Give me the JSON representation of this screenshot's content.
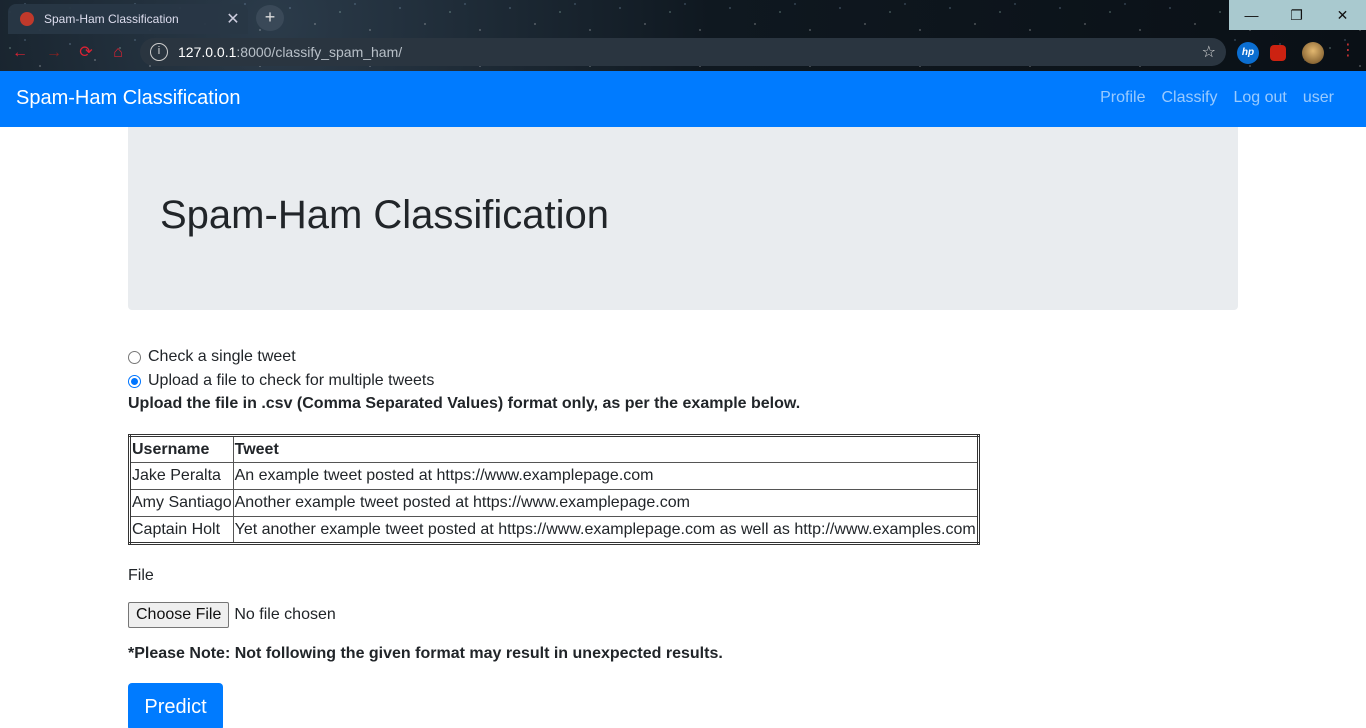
{
  "browser": {
    "tab_title": "Spam-Ham Classification",
    "url_host": "127.0.0.1",
    "url_rest": ":8000/classify_spam_ham/",
    "ext_hp_label": "hp"
  },
  "navbar": {
    "brand": "Spam-Ham Classification",
    "links": [
      "Profile",
      "Classify",
      "Log out",
      "user"
    ],
    "color": "#007bff"
  },
  "jumbotron": {
    "heading": "Spam-Ham Classification"
  },
  "form": {
    "options": [
      {
        "label": "Check a single tweet",
        "checked": false
      },
      {
        "label": "Upload a file to check for multiple tweets",
        "checked": true
      }
    ],
    "instruction": "Upload the file in .csv (Comma Separated Values) format only, as per the example below.",
    "table": {
      "headers": [
        "Username",
        "Tweet"
      ],
      "rows": [
        [
          "Jake Peralta",
          "An example tweet posted at https://www.examplepage.com"
        ],
        [
          "Amy Santiago",
          "Another example tweet posted at https://www.examplepage.com"
        ],
        [
          "Captain Holt",
          "Yet another example tweet posted at https://www.examplepage.com as well as http://www.examples.com"
        ]
      ]
    },
    "file_label": "File",
    "file_button": "Choose File",
    "file_status": "No file chosen",
    "note": "*Please Note: Not following the given format may result in unexpected results.",
    "submit": "Predict"
  }
}
